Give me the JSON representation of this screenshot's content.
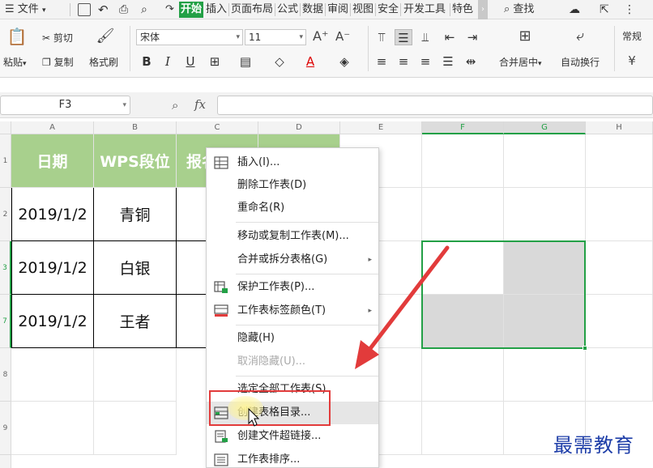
{
  "titlebar": {
    "file_menu": "文件",
    "tabs": [
      "开始",
      "插入",
      "页面布局",
      "公式",
      "数据",
      "审阅",
      "视图",
      "安全",
      "开发工具",
      "特色"
    ],
    "active_tab": "开始",
    "search_label": "查找"
  },
  "ribbon": {
    "paste_label": "粘贴",
    "cut_label": "剪切",
    "copy_label": "复制",
    "format_painter_label": "格式刷",
    "font_name": "宋体",
    "font_size": "11",
    "bold": "B",
    "italic": "I",
    "underline": "U",
    "merge_label": "合并居中",
    "wrap_label": "自动换行",
    "number_format": "常规"
  },
  "formula_bar": {
    "name_box": "F3",
    "fx_label": "fx",
    "value": ""
  },
  "grid": {
    "columns": [
      "A",
      "B",
      "C",
      "D",
      "E",
      "F",
      "G",
      "H"
    ],
    "rows": [
      "1",
      "2",
      "3",
      "7",
      "8",
      "9"
    ],
    "header_row": [
      "日期",
      "WPS段位",
      "报名"
    ],
    "data_rows": [
      [
        "2019/1/2",
        "青铜"
      ],
      [
        "2019/1/2",
        "白银"
      ],
      [
        "2019/1/2",
        "王者"
      ]
    ]
  },
  "context_menu": {
    "items": [
      {
        "label": "插入(I)...",
        "icon": "insert-table-icon"
      },
      {
        "label": "删除工作表(D)"
      },
      {
        "label": "重命名(R)"
      },
      {
        "label": "移动或复制工作表(M)..."
      },
      {
        "label": "合并或拆分表格(G)",
        "submenu": true
      },
      {
        "label": "保护工作表(P)...",
        "icon": "protect-sheet-icon"
      },
      {
        "label": "工作表标签颜色(T)",
        "icon": "tab-color-icon",
        "submenu": true
      },
      {
        "label": "隐藏(H)"
      },
      {
        "label": "取消隐藏(U)...",
        "disabled": true
      },
      {
        "label": "选定全部工作表(S)"
      },
      {
        "label": "创建表格目录...",
        "icon": "table-directory-icon",
        "hovered": true
      },
      {
        "label": "创建文件超链接...",
        "icon": "file-hyperlink-icon"
      },
      {
        "label": "工作表排序...",
        "icon": "sheet-sort-icon"
      }
    ]
  },
  "watermark": "最需教育",
  "colors": {
    "accent_green": "#23a046",
    "header_fill": "#a8d08d",
    "annotation_red": "#e23b3b",
    "watermark_blue": "#1e3ea8"
  }
}
